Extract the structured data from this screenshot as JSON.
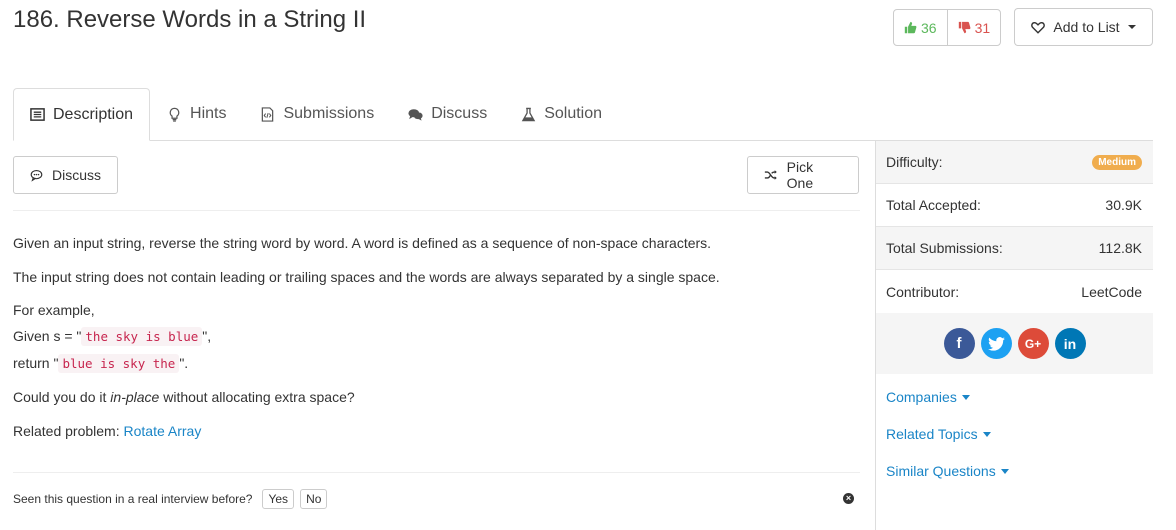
{
  "problem": {
    "title": "186. Reverse Words in a String II"
  },
  "votes": {
    "up": "36",
    "down": "31"
  },
  "add_to_list": "Add to List",
  "tabs": [
    {
      "label": "Description",
      "icon": "description-icon"
    },
    {
      "label": "Hints",
      "icon": "lightbulb-icon"
    },
    {
      "label": "Submissions",
      "icon": "code-file-icon"
    },
    {
      "label": "Discuss",
      "icon": "comments-icon"
    },
    {
      "label": "Solution",
      "icon": "flask-icon"
    }
  ],
  "buttons": {
    "discuss": "Discuss",
    "pick_one": "Pick One"
  },
  "description": {
    "p1": "Given an input string, reverse the string word by word. A word is defined as a sequence of non-space characters.",
    "p2": "The input string does not contain leading or trailing spaces and the words are always separated by a single space.",
    "example_intro": "For example,",
    "given_prefix": "Given s = \"",
    "given_code": "the sky is blue",
    "given_suffix": "\",",
    "return_prefix": "return \"",
    "return_code": "blue is sky the",
    "return_suffix": "\".",
    "could_prefix": "Could you do it ",
    "could_em": "in-place",
    "could_suffix": " without allocating extra space?",
    "related_prefix": "Related problem: ",
    "related_link": "Rotate Array"
  },
  "interview": {
    "question": "Seen this question in a real interview before?",
    "yes": "Yes",
    "no": "No"
  },
  "sidebar": {
    "difficulty_label": "Difficulty:",
    "difficulty_value": "Medium",
    "accepted_label": "Total Accepted:",
    "accepted_value": "30.9K",
    "submissions_label": "Total Submissions:",
    "submissions_value": "112.8K",
    "contributor_label": "Contributor:",
    "contributor_value": "LeetCode",
    "companies": "Companies",
    "related_topics": "Related Topics",
    "similar_questions": "Similar Questions"
  },
  "colors": {
    "link": "#1a85c7",
    "upvote": "#5cb85c",
    "downvote": "#d9534f",
    "medium_badge": "#f0ad4e"
  }
}
